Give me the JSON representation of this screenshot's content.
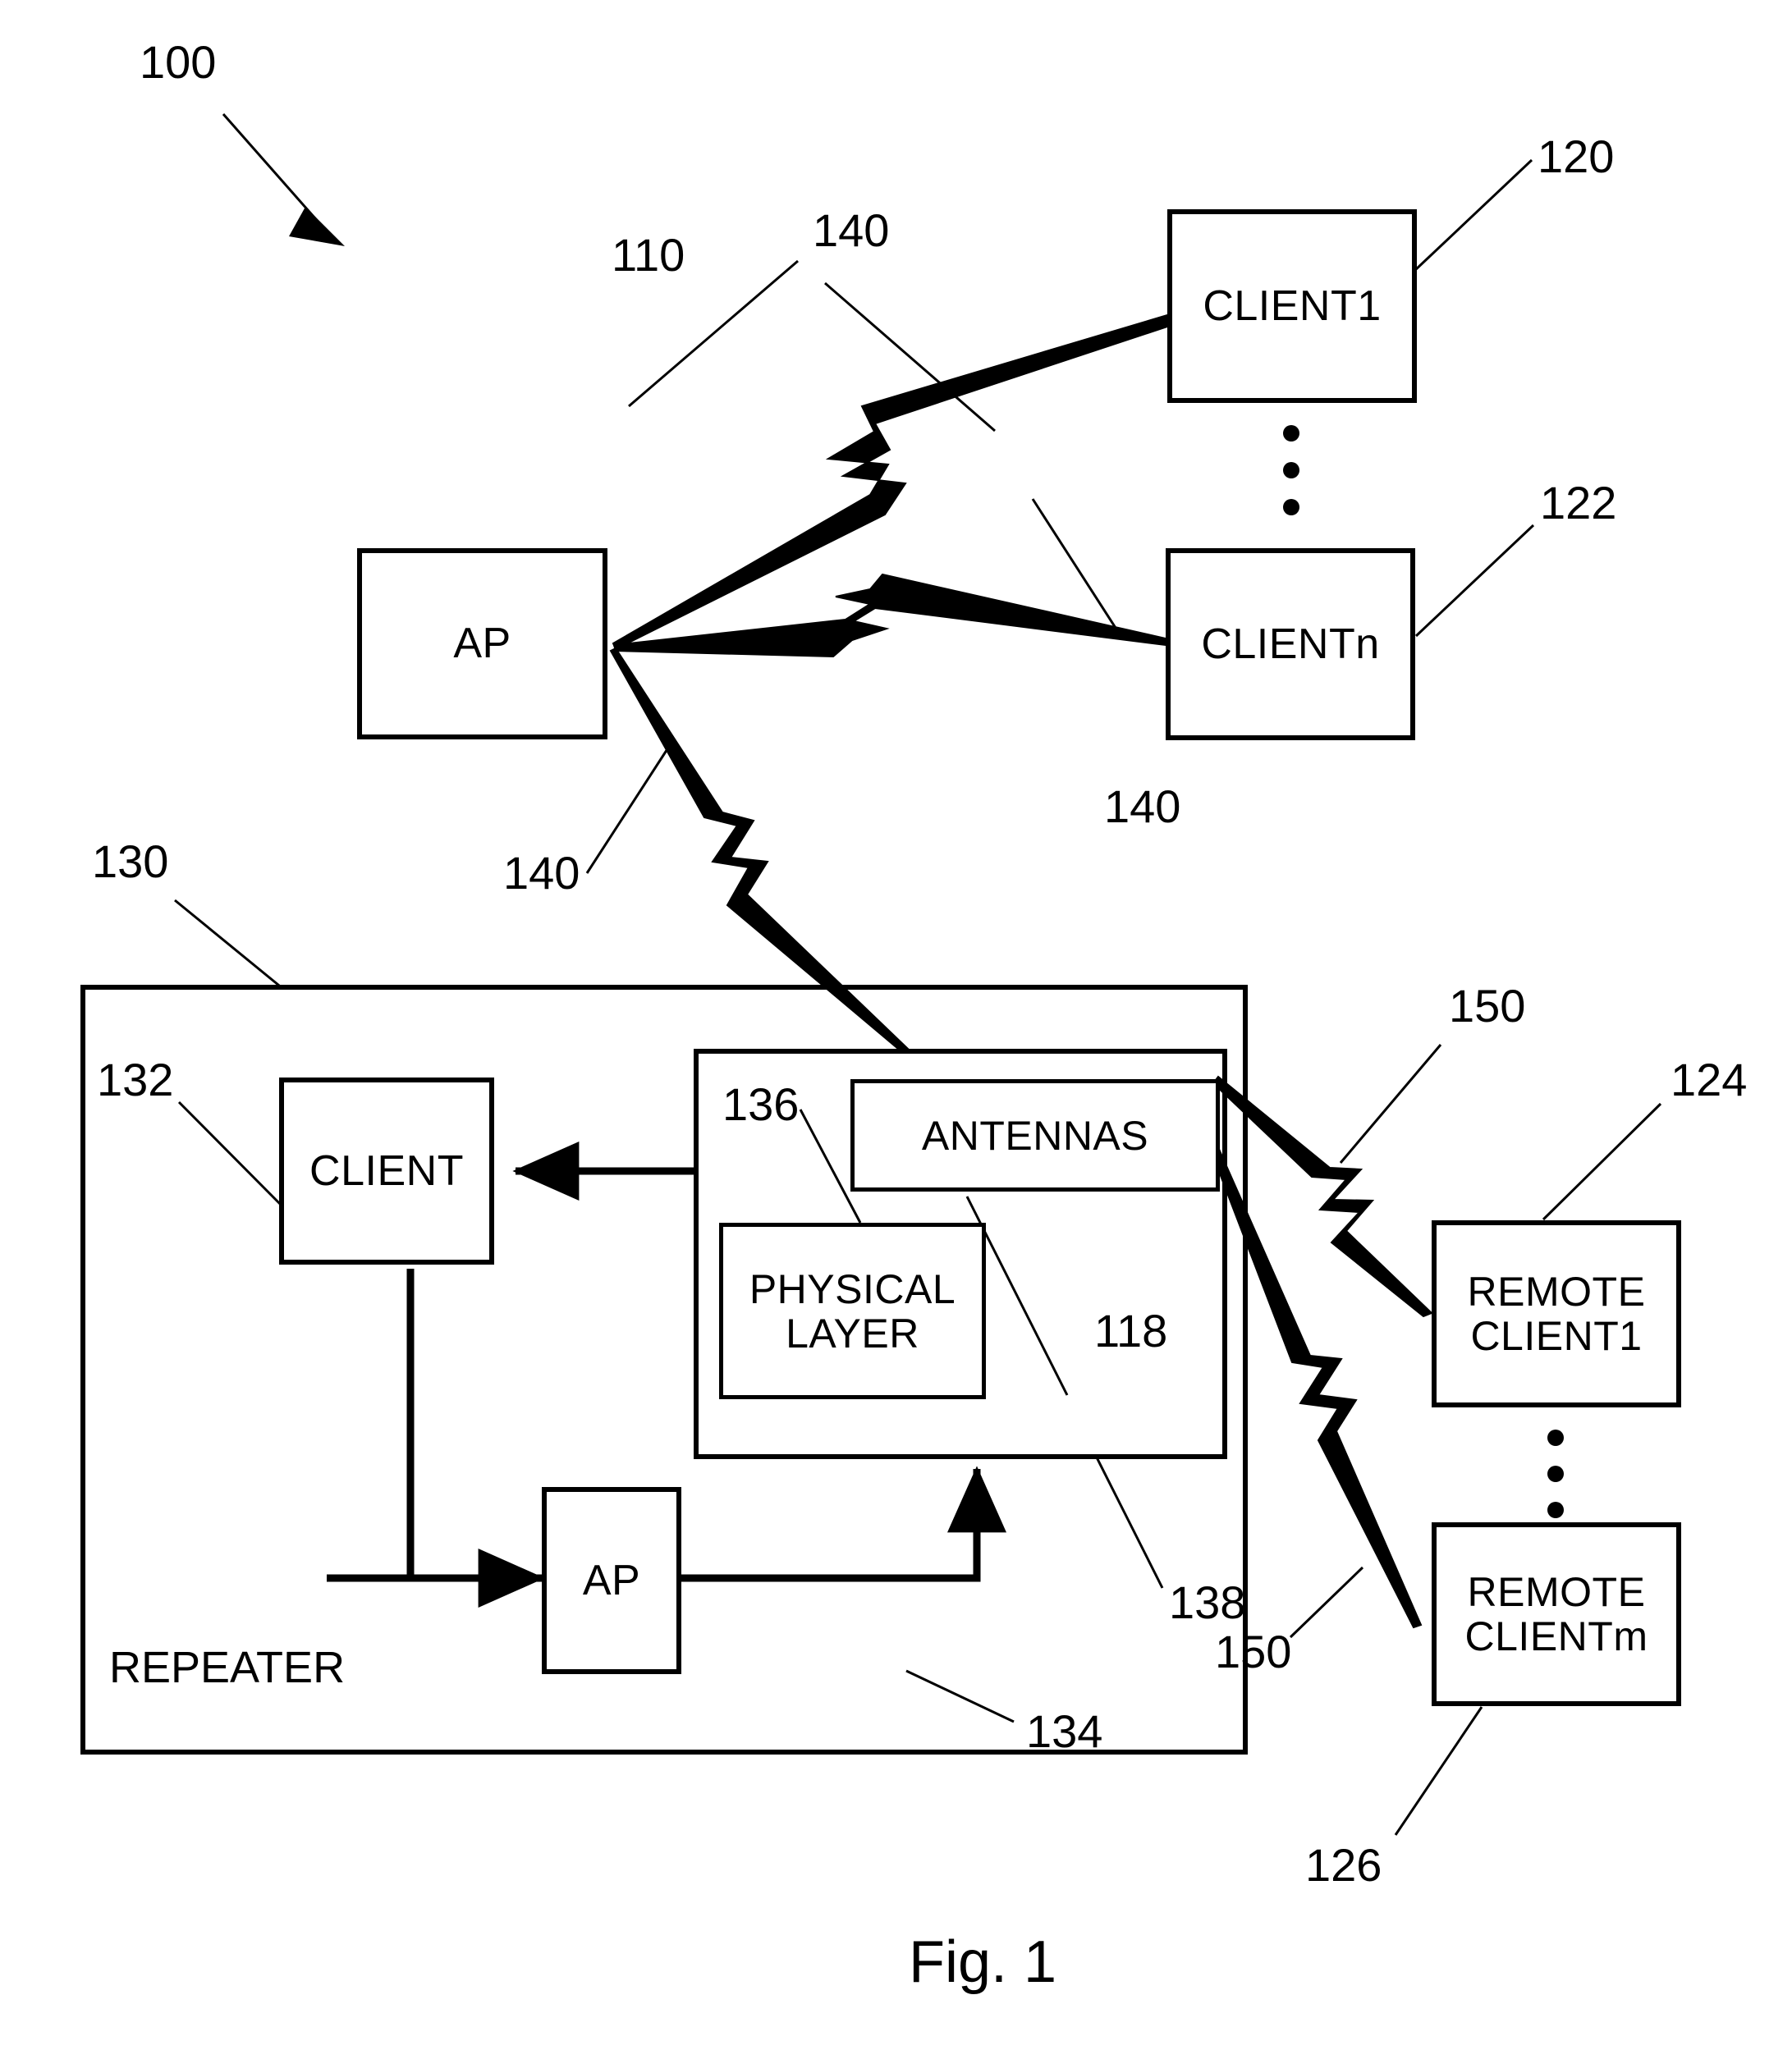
{
  "figure": {
    "caption": "Fig. 1",
    "system_ref": "100"
  },
  "nodes": {
    "ap": {
      "label": "AP",
      "ref": "110"
    },
    "client1": {
      "label": "CLIENT1",
      "ref": "120"
    },
    "clientn": {
      "label": "CLIENTn",
      "ref": "122"
    },
    "repeater": {
      "label": "REPEATER",
      "ref": "130"
    },
    "repeater_client": {
      "label": "CLIENT",
      "ref": "132"
    },
    "repeater_ap": {
      "label": "AP",
      "ref": "134"
    },
    "radio_module": {
      "ref": "138"
    },
    "physical_layer": {
      "label": "PHYSICAL\nLAYER",
      "line1": "PHYSICAL",
      "line2": "LAYER",
      "ref": "136"
    },
    "antennas": {
      "label": "ANTENNAS",
      "ref": "118"
    },
    "remote_client1": {
      "line1": "REMOTE",
      "line2": "CLIENT1",
      "ref": "124"
    },
    "remote_clientm": {
      "line1": "REMOTE",
      "line2": "CLIENTm",
      "ref": "126"
    }
  },
  "links": {
    "ap_to_client1": {
      "ref": "140"
    },
    "ap_to_clientn": {
      "ref": "140"
    },
    "ap_to_repeater": {
      "ref": "140"
    },
    "repeater_to_remote1": {
      "ref": "150"
    },
    "repeater_to_remotem": {
      "ref": "150"
    }
  },
  "refs": {
    "r100": "100",
    "r110": "110",
    "r118": "118",
    "r120": "120",
    "r122": "122",
    "r124": "124",
    "r126": "126",
    "r130": "130",
    "r132": "132",
    "r134": "134",
    "r136": "136",
    "r138": "138",
    "r140_top": "140",
    "r140_mid": "140",
    "r140_low": "140",
    "r150_top": "150",
    "r150_low": "150"
  },
  "colors": {
    "stroke": "#000000",
    "background": "#ffffff"
  }
}
